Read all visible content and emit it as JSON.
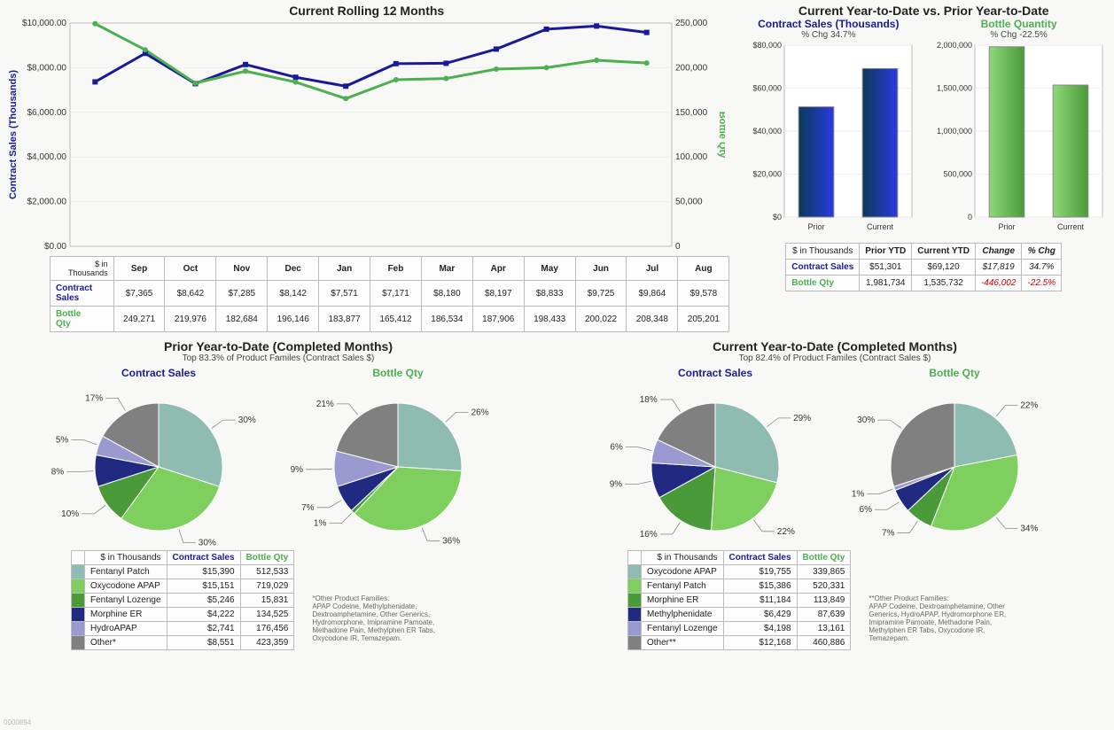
{
  "top_left": {
    "title": "Current Rolling 12 Months",
    "y1_label": "Contract Sales (Thousands)",
    "y2_label": "Bottle Qty",
    "table_header": "$ in\nThousands",
    "row1_label": "Contract\nSales",
    "row2_label": "Bottle\nQty"
  },
  "top_right": {
    "title": "Current Year-to-Date vs. Prior Year-to-Date",
    "cs_title": "Contract Sales (Thousands)",
    "cs_sub": "% Chg 34.7%",
    "bq_title": "Bottle Quantity",
    "bq_sub": "% Chg -22.5%",
    "prior_label": "Prior",
    "current_label": "Current",
    "tbl_header0": "$ in Thousands",
    "tbl_header1": "Prior YTD",
    "tbl_header2": "Current YTD",
    "tbl_header3": "Change",
    "tbl_header4": "% Chg",
    "tbl_row1_label": "Contract Sales",
    "tbl_row2_label": "Bottle Qty",
    "tbl_cs_prior": "$51,301",
    "tbl_cs_current": "$69,120",
    "tbl_cs_change": "$17,819",
    "tbl_cs_pct": "34.7%",
    "tbl_bq_prior": "1,981,734",
    "tbl_bq_current": "1,535,732",
    "tbl_bq_change": "-446,002",
    "tbl_bq_pct": "-22.5%"
  },
  "prior_ytd": {
    "title": "Prior Year-to-Date (Completed Months)",
    "sub": "Top 83.3% of Product Familes (Contract Sales $)",
    "cs_title": "Contract Sales",
    "bq_title": "Bottle Qty",
    "tbl_header0": "$ in Thousands",
    "tbl_header1": "Contract Sales",
    "tbl_header2": "Bottle Qty",
    "rows": [
      {
        "name": "Fentanyl Patch",
        "cs": "$15,390",
        "bq": "512,533",
        "color": "#8fbcb0"
      },
      {
        "name": "Oxycodone APAP",
        "cs": "$15,151",
        "bq": "719,029",
        "color": "#7fcf5f"
      },
      {
        "name": "Fentanyl Lozenge",
        "cs": "$5,246",
        "bq": "15,831",
        "color": "#4a9a3a"
      },
      {
        "name": "Morphine ER",
        "cs": "$4,222",
        "bq": "134,525",
        "color": "#1f2a80"
      },
      {
        "name": "HydroAPAP",
        "cs": "$2,741",
        "bq": "176,456",
        "color": "#9a9ad0"
      },
      {
        "name": "Other*",
        "cs": "$8,551",
        "bq": "423,359",
        "color": "#808080"
      }
    ],
    "footnote_label": "*Other Product Families:",
    "footnote_text": "APAP Codeine, Methylphenidate, Dextroamphetamine, Other Generics, Hydromorphone, Imipramine Pamoate, Methadone Pain, Methylphen ER Tabs, Oxycodone IR, Temazepam."
  },
  "current_ytd": {
    "title": "Current Year-to-Date (Completed Months)",
    "sub": "Top 82.4% of Product Familes (Contract Sales $)",
    "cs_title": "Contract Sales",
    "bq_title": "Bottle Qty",
    "tbl_header0": "$ in Thousands",
    "tbl_header1": "Contract Sales",
    "tbl_header2": "Bottle Qty",
    "rows": [
      {
        "name": "Oxycodone APAP",
        "cs": "$19,755",
        "bq": "339,865",
        "color": "#8fbcb0"
      },
      {
        "name": "Fentanyl Patch",
        "cs": "$15,386",
        "bq": "520,331",
        "color": "#7fcf5f"
      },
      {
        "name": "Morphine ER",
        "cs": "$11,184",
        "bq": "113,849",
        "color": "#4a9a3a"
      },
      {
        "name": "Methylphenidate",
        "cs": "$6,429",
        "bq": "87,639",
        "color": "#1f2a80"
      },
      {
        "name": "Fentanyl Lozenge",
        "cs": "$4,198",
        "bq": "13,161",
        "color": "#9a9ad0"
      },
      {
        "name": "Other**",
        "cs": "$12,168",
        "bq": "460,886",
        "color": "#808080"
      }
    ],
    "footnote_label": "**Other Product Families:",
    "footnote_text": "APAP Codeine, Dextroamphetamine, Other Generics, HydroAPAP, Hydromorphone ER, Imipramine Pamoate, Methadone Pain, Methylphen ER Tabs, Oxycodone IR, Temazepam."
  },
  "footer_id": "0000894",
  "chart_data": {
    "rolling_12": {
      "type": "line",
      "categories": [
        "Sep",
        "Oct",
        "Nov",
        "Dec",
        "Jan",
        "Feb",
        "Mar",
        "Apr",
        "May",
        "Jun",
        "Jul",
        "Aug"
      ],
      "series": [
        {
          "name": "Contract Sales",
          "axis": "left",
          "values": [
            7365,
            8642,
            7285,
            8142,
            7571,
            7171,
            8180,
            8197,
            8833,
            9725,
            9864,
            9578
          ],
          "display": [
            "$7,365",
            "$8,642",
            "$7,285",
            "$8,142",
            "$7,571",
            "$7,171",
            "$8,180",
            "$8,197",
            "$8,833",
            "$9,725",
            "$9,864",
            "$9,578"
          ]
        },
        {
          "name": "Bottle Qty",
          "axis": "right",
          "values": [
            249271,
            219976,
            182684,
            196146,
            183877,
            165412,
            186534,
            187906,
            198433,
            200022,
            208348,
            205201
          ],
          "display": [
            "249,271",
            "219,976",
            "182,684",
            "196,146",
            "183,877",
            "165,412",
            "186,534",
            "187,906",
            "198,433",
            "200,022",
            "208,348",
            "205,201"
          ]
        }
      ],
      "y1_ticks": [
        "$0.00",
        "$2,000.00",
        "$4,000.00",
        "$6,000.00",
        "$8,000.00",
        "$10,000.00"
      ],
      "y1_range": [
        0,
        10000
      ],
      "y2_ticks": [
        "0",
        "50,000",
        "100,000",
        "150,000",
        "200,000",
        "250,000"
      ],
      "y2_range": [
        0,
        250000
      ]
    },
    "ytd_bars": [
      {
        "type": "bar",
        "name": "Contract Sales (Thousands)",
        "categories": [
          "Prior",
          "Current"
        ],
        "values": [
          51301,
          69120
        ],
        "ylim": [
          0,
          80000
        ],
        "yticks": [
          "$0",
          "$20,000",
          "$40,000",
          "$60,000",
          "$80,000"
        ]
      },
      {
        "type": "bar",
        "name": "Bottle Quantity",
        "categories": [
          "Prior",
          "Current"
        ],
        "values": [
          1981734,
          1535732
        ],
        "ylim": [
          0,
          2000000
        ],
        "yticks": [
          "0",
          "500,000",
          "1,000,000",
          "1,500,000",
          "2,000,000"
        ]
      }
    ],
    "prior_pies": {
      "contract_sales": {
        "type": "pie",
        "slices": [
          {
            "label": "Fentanyl Patch",
            "pct": 30,
            "color": "#8fbcb0"
          },
          {
            "label": "Oxycodone APAP",
            "pct": 30,
            "color": "#7fcf5f"
          },
          {
            "label": "Fentanyl Lozenge",
            "pct": 10,
            "color": "#4a9a3a"
          },
          {
            "label": "Morphine ER",
            "pct": 8,
            "color": "#1f2a80"
          },
          {
            "label": "HydroAPAP",
            "pct": 5,
            "color": "#9a9ad0"
          },
          {
            "label": "Other",
            "pct": 17,
            "color": "#808080"
          }
        ]
      },
      "bottle_qty": {
        "type": "pie",
        "slices": [
          {
            "label": "Fentanyl Patch",
            "pct": 26,
            "color": "#8fbcb0"
          },
          {
            "label": "Oxycodone APAP",
            "pct": 36,
            "color": "#7fcf5f"
          },
          {
            "label": "Fentanyl Lozenge",
            "pct": 1,
            "color": "#4a9a3a"
          },
          {
            "label": "Morphine ER",
            "pct": 7,
            "color": "#1f2a80"
          },
          {
            "label": "HydroAPAP",
            "pct": 9,
            "color": "#9a9ad0"
          },
          {
            "label": "Other",
            "pct": 21,
            "color": "#808080"
          }
        ]
      }
    },
    "current_pies": {
      "contract_sales": {
        "type": "pie",
        "slices": [
          {
            "label": "Oxycodone APAP",
            "pct": 29,
            "color": "#8fbcb0"
          },
          {
            "label": "Fentanyl Patch",
            "pct": 22,
            "color": "#7fcf5f"
          },
          {
            "label": "Morphine ER",
            "pct": 16,
            "color": "#4a9a3a"
          },
          {
            "label": "Methylphenidate",
            "pct": 9,
            "color": "#1f2a80"
          },
          {
            "label": "Fentanyl Lozenge",
            "pct": 6,
            "color": "#9a9ad0"
          },
          {
            "label": "Other",
            "pct": 18,
            "color": "#808080"
          }
        ]
      },
      "bottle_qty": {
        "type": "pie",
        "slices": [
          {
            "label": "Oxycodone APAP",
            "pct": 22,
            "color": "#8fbcb0"
          },
          {
            "label": "Fentanyl Patch",
            "pct": 34,
            "color": "#7fcf5f"
          },
          {
            "label": "Morphine ER",
            "pct": 7,
            "color": "#4a9a3a"
          },
          {
            "label": "Methylphenidate",
            "pct": 6,
            "color": "#1f2a80"
          },
          {
            "label": "Fentanyl Lozenge",
            "pct": 1,
            "color": "#9a9ad0"
          },
          {
            "label": "Other",
            "pct": 30,
            "color": "#808080"
          }
        ]
      }
    }
  }
}
